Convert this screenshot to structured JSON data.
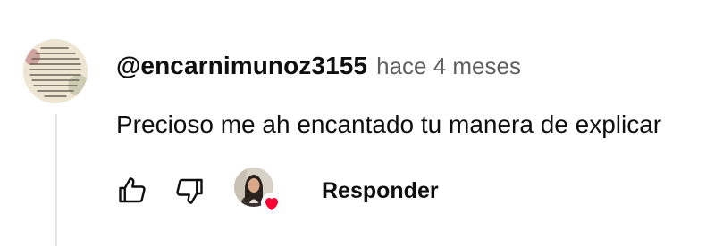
{
  "comment": {
    "author": "@encarnimunoz3155",
    "time": "hace 4 meses",
    "text": "Precioso me ah encantado tu manera de explicar"
  },
  "actions": {
    "reply_label": "Responder",
    "like_icon": "thumb-up-outline-icon",
    "dislike_icon": "thumb-down-outline-icon",
    "heart_icon": "creator-heart-icon"
  },
  "colors": {
    "text_primary": "#0f0f0f",
    "text_secondary": "#606060",
    "heart": "#ff0033",
    "thread_line": "#e5e5e5"
  }
}
